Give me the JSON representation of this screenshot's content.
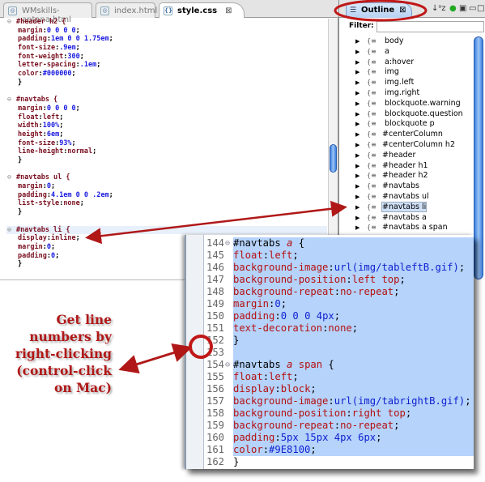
{
  "editor": {
    "tabs": [
      {
        "label": "WMskills-aptana.html",
        "active": false
      },
      {
        "label": "index.html",
        "active": false
      },
      {
        "label": "style.css",
        "active": true
      }
    ],
    "lines": [
      [
        {
          "t": "#header h2 {",
          "c": "sel",
          "fold": true
        }
      ],
      [
        {
          "t": "margin",
          "c": "prop"
        },
        {
          "t": ":",
          "c": "pun"
        },
        {
          "t": "0 0 0 0",
          "c": "val"
        },
        {
          "t": ";",
          "c": "pun"
        }
      ],
      [
        {
          "t": "padding",
          "c": "prop"
        },
        {
          "t": ":",
          "c": "pun"
        },
        {
          "t": "1em 0 0 1.75em",
          "c": "val"
        },
        {
          "t": ";",
          "c": "pun"
        }
      ],
      [
        {
          "t": "font-size",
          "c": "prop"
        },
        {
          "t": ":",
          "c": "pun"
        },
        {
          "t": ".9em",
          "c": "val"
        },
        {
          "t": ";",
          "c": "pun"
        }
      ],
      [
        {
          "t": "font-weight",
          "c": "prop"
        },
        {
          "t": ":",
          "c": "pun"
        },
        {
          "t": "300",
          "c": "val"
        },
        {
          "t": ";",
          "c": "pun"
        }
      ],
      [
        {
          "t": "letter-spacing",
          "c": "prop"
        },
        {
          "t": ":",
          "c": "pun"
        },
        {
          "t": ".1em",
          "c": "val"
        },
        {
          "t": ";",
          "c": "pun"
        }
      ],
      [
        {
          "t": "color",
          "c": "prop"
        },
        {
          "t": ":",
          "c": "pun"
        },
        {
          "t": "#000000",
          "c": "val"
        },
        {
          "t": ";",
          "c": "pun"
        }
      ],
      [
        {
          "t": "}",
          "c": "pun"
        }
      ],
      [],
      [
        {
          "t": "#navtabs {",
          "c": "sel",
          "fold": true
        }
      ],
      [
        {
          "t": "margin",
          "c": "prop"
        },
        {
          "t": ":",
          "c": "pun"
        },
        {
          "t": "0 0 0 0",
          "c": "val"
        },
        {
          "t": ";",
          "c": "pun"
        }
      ],
      [
        {
          "t": "float",
          "c": "prop"
        },
        {
          "t": ":",
          "c": "pun"
        },
        {
          "t": "left",
          "c": "prop"
        },
        {
          "t": ";",
          "c": "pun"
        }
      ],
      [
        {
          "t": "width",
          "c": "prop"
        },
        {
          "t": ":",
          "c": "pun"
        },
        {
          "t": "100%",
          "c": "val"
        },
        {
          "t": ";",
          "c": "pun"
        }
      ],
      [
        {
          "t": "height",
          "c": "prop"
        },
        {
          "t": ":",
          "c": "pun"
        },
        {
          "t": "6em",
          "c": "val"
        },
        {
          "t": ";",
          "c": "pun"
        }
      ],
      [
        {
          "t": "font-size",
          "c": "prop"
        },
        {
          "t": ":",
          "c": "pun"
        },
        {
          "t": "93%",
          "c": "val"
        },
        {
          "t": ";",
          "c": "pun"
        }
      ],
      [
        {
          "t": "line-height",
          "c": "prop"
        },
        {
          "t": ":",
          "c": "pun"
        },
        {
          "t": "normal",
          "c": "prop"
        },
        {
          "t": ";",
          "c": "pun"
        }
      ],
      [
        {
          "t": "}",
          "c": "pun"
        }
      ],
      [],
      [
        {
          "t": "#navtabs ul {",
          "c": "sel",
          "fold": true
        }
      ],
      [
        {
          "t": "margin",
          "c": "prop"
        },
        {
          "t": ":",
          "c": "pun"
        },
        {
          "t": "0",
          "c": "val"
        },
        {
          "t": ";",
          "c": "pun"
        }
      ],
      [
        {
          "t": "padding",
          "c": "prop"
        },
        {
          "t": ":",
          "c": "pun"
        },
        {
          "t": "4.1em 0 0 .2em",
          "c": "val"
        },
        {
          "t": ";",
          "c": "pun"
        }
      ],
      [
        {
          "t": "list-style",
          "c": "prop"
        },
        {
          "t": ":",
          "c": "pun"
        },
        {
          "t": "none",
          "c": "prop"
        },
        {
          "t": ";",
          "c": "pun"
        }
      ],
      [
        {
          "t": "}",
          "c": "pun"
        }
      ],
      [],
      [
        {
          "t": "#navtabs li {",
          "c": "sel",
          "fold": true,
          "hl": true
        }
      ],
      [
        {
          "t": "display",
          "c": "prop"
        },
        {
          "t": ":",
          "c": "pun"
        },
        {
          "t": "inline",
          "c": "prop"
        },
        {
          "t": ";",
          "c": "pun"
        }
      ],
      [
        {
          "t": "margin",
          "c": "prop"
        },
        {
          "t": ":",
          "c": "pun"
        },
        {
          "t": "0",
          "c": "val"
        },
        {
          "t": ";",
          "c": "pun"
        }
      ],
      [
        {
          "t": "padding",
          "c": "prop"
        },
        {
          "t": ":",
          "c": "pun"
        },
        {
          "t": "0",
          "c": "val"
        },
        {
          "t": ";",
          "c": "pun"
        }
      ],
      [
        {
          "t": "}",
          "c": "pun"
        }
      ]
    ]
  },
  "outline": {
    "tab_label": "Outline",
    "filter_label": "Filter:",
    "filter_value": "",
    "selected": "#navtabs li",
    "items": [
      "body",
      "a",
      "a:hover",
      "img",
      "img.left",
      "img.right",
      "blockquote.warning",
      "blockquote.question",
      "blockquote p",
      "#centerColumn",
      "#centerColumn h2",
      "#header",
      "#header h1",
      "#header h2",
      "#navtabs",
      "#navtabs ul",
      "#navtabs li",
      "#navtabs a",
      "#navtabs a span"
    ]
  },
  "popup": {
    "lines": [
      {
        "n": "144",
        "fold": true,
        "seg": [
          {
            "t": "#navtabs ",
            "c": "pun"
          },
          {
            "t": "a",
            "c": "it"
          },
          {
            "t": " {",
            "c": "pun"
          }
        ]
      },
      {
        "n": "145",
        "seg": [
          {
            "t": "float",
            "c": "kw"
          },
          {
            "t": ":",
            "c": "pun"
          },
          {
            "t": "left",
            "c": "kw"
          },
          {
            "t": ";",
            "c": "pun"
          }
        ]
      },
      {
        "n": "146",
        "seg": [
          {
            "t": "background-image",
            "c": "kw"
          },
          {
            "t": ":",
            "c": "pun"
          },
          {
            "t": "url(img/tableftB.gif)",
            "c": "pv"
          },
          {
            "t": ";",
            "c": "pun"
          }
        ]
      },
      {
        "n": "147",
        "seg": [
          {
            "t": "background-position",
            "c": "kw"
          },
          {
            "t": ":",
            "c": "pun"
          },
          {
            "t": "left top",
            "c": "kw"
          },
          {
            "t": ";",
            "c": "pun"
          }
        ]
      },
      {
        "n": "148",
        "seg": [
          {
            "t": "background-repeat",
            "c": "kw"
          },
          {
            "t": ":",
            "c": "pun"
          },
          {
            "t": "no-repeat",
            "c": "kw"
          },
          {
            "t": ";",
            "c": "pun"
          }
        ]
      },
      {
        "n": "149",
        "seg": [
          {
            "t": "margin",
            "c": "kw"
          },
          {
            "t": ":",
            "c": "pun"
          },
          {
            "t": "0",
            "c": "pv"
          },
          {
            "t": ";",
            "c": "pun"
          }
        ]
      },
      {
        "n": "150",
        "seg": [
          {
            "t": "padding",
            "c": "kw"
          },
          {
            "t": ":",
            "c": "pun"
          },
          {
            "t": "0 0 0 4px",
            "c": "pv"
          },
          {
            "t": ";",
            "c": "pun"
          }
        ]
      },
      {
        "n": "151",
        "seg": [
          {
            "t": "text-decoration",
            "c": "kw"
          },
          {
            "t": ":",
            "c": "pun"
          },
          {
            "t": "none",
            "c": "kw"
          },
          {
            "t": ";",
            "c": "pun"
          }
        ]
      },
      {
        "n": "152",
        "seg": [
          {
            "t": "}",
            "c": "pun"
          }
        ]
      },
      {
        "n": "153",
        "seg": []
      },
      {
        "n": "154",
        "fold": true,
        "seg": [
          {
            "t": "#navtabs ",
            "c": "pun"
          },
          {
            "t": "a",
            "c": "it"
          },
          {
            "t": " span",
            "c": "kw"
          },
          {
            "t": " {",
            "c": "pun"
          }
        ]
      },
      {
        "n": "155",
        "seg": [
          {
            "t": "float",
            "c": "kw"
          },
          {
            "t": ":",
            "c": "pun"
          },
          {
            "t": "left",
            "c": "kw"
          },
          {
            "t": ";",
            "c": "pun"
          }
        ]
      },
      {
        "n": "156",
        "seg": [
          {
            "t": "display",
            "c": "kw"
          },
          {
            "t": ":",
            "c": "pun"
          },
          {
            "t": "block",
            "c": "kw"
          },
          {
            "t": ";",
            "c": "pun"
          }
        ]
      },
      {
        "n": "157",
        "seg": [
          {
            "t": "background-image",
            "c": "kw"
          },
          {
            "t": ":",
            "c": "pun"
          },
          {
            "t": "url(img/tabrightB.gif)",
            "c": "pv"
          },
          {
            "t": ";",
            "c": "pun"
          }
        ]
      },
      {
        "n": "158",
        "seg": [
          {
            "t": "background-position",
            "c": "kw"
          },
          {
            "t": ":",
            "c": "pun"
          },
          {
            "t": "right top",
            "c": "kw"
          },
          {
            "t": ";",
            "c": "pun"
          }
        ]
      },
      {
        "n": "159",
        "seg": [
          {
            "t": "background-repeat",
            "c": "kw"
          },
          {
            "t": ":",
            "c": "pun"
          },
          {
            "t": "no-repeat",
            "c": "kw"
          },
          {
            "t": ";",
            "c": "pun"
          }
        ]
      },
      {
        "n": "160",
        "seg": [
          {
            "t": "padding",
            "c": "kw"
          },
          {
            "t": ":",
            "c": "pun"
          },
          {
            "t": "5px 15px 4px 6px",
            "c": "pv"
          },
          {
            "t": ";",
            "c": "pun"
          }
        ]
      },
      {
        "n": "161",
        "seg": [
          {
            "t": "color",
            "c": "kw"
          },
          {
            "t": ":",
            "c": "pun"
          },
          {
            "t": "#9E8100",
            "c": "pv"
          },
          {
            "t": ";",
            "c": "pun"
          }
        ]
      },
      {
        "n": "162",
        "last": true,
        "seg": [
          {
            "t": "}",
            "c": "pun"
          }
        ]
      }
    ]
  },
  "annotation": {
    "lines": [
      "Get line",
      "numbers by",
      "right-clicking",
      "(control-click",
      "on Mac)"
    ],
    "color": "#b01818"
  },
  "colors": {
    "selection": "#b5d3fb",
    "annotation": "#b01818"
  }
}
